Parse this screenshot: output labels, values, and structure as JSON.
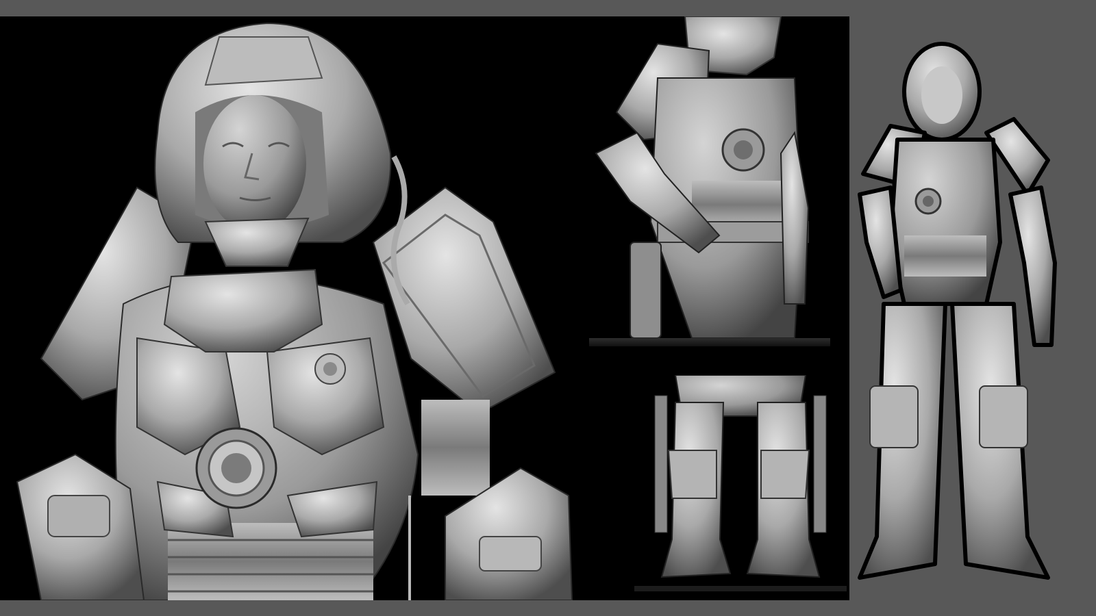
{
  "artwork": {
    "panels": [
      {
        "id": "main",
        "view": "close-up bust"
      },
      {
        "id": "torso",
        "view": "mid-body"
      },
      {
        "id": "legs",
        "view": "legs"
      },
      {
        "id": "full",
        "view": "full-body"
      }
    ]
  },
  "colors": {
    "frame": "#585858",
    "background": "#000000",
    "clay_light": "#d8d8d8",
    "clay_mid": "#a5a5a5",
    "clay_dark": "#5e5e5e"
  },
  "icons": [
    "helmet-icon",
    "chest-reactor-icon"
  ]
}
